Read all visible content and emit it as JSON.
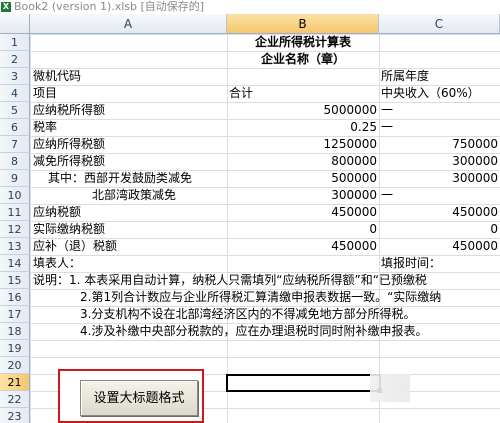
{
  "window": {
    "title": "Book2 (version 1).xlsb [自动保存的]"
  },
  "columns": [
    "A",
    "B",
    "C"
  ],
  "rows": [
    "1",
    "2",
    "3",
    "4",
    "5",
    "6",
    "7",
    "8",
    "9",
    "10",
    "11",
    "12",
    "13",
    "14",
    "15",
    "16",
    "17",
    "18",
    "19",
    "20",
    "21",
    "22",
    "23"
  ],
  "cells": {
    "r1_title": "企业所得税计算表",
    "r2_company": "企业名称（章）",
    "r3_a": "微机代码",
    "r3_c": "所属年度",
    "r4_a": "项目",
    "r4_b": "合计",
    "r4_c": "中央收入（60%）",
    "r5_a": "应纳税所得额",
    "r5_b": "5000000",
    "r5_c": "一",
    "r6_a": "税率",
    "r6_b": "0.25",
    "r6_c": "一",
    "r7_a": "应纳所得税额",
    "r7_b": "1250000",
    "r7_c": "750000",
    "r8_a": "减免所得税额",
    "r8_b": "800000",
    "r8_c": "300000",
    "r9_a": "其中：西部开发鼓励类减免",
    "r9_b": "500000",
    "r9_c": "300000",
    "r10_a": "北部湾政策减免",
    "r10_b": "300000",
    "r10_c": "一",
    "r11_a": "应纳税额",
    "r11_b": "450000",
    "r11_c": "450000",
    "r12_a": "实际缴纳税额",
    "r12_b": "0",
    "r12_c": "0",
    "r13_a": "应补（退）税额",
    "r13_b": "450000",
    "r13_c": "450000",
    "r14_a": "填表人：",
    "r14_c": "填报时间：",
    "r15": "说明：1. 本表采用自动计算，纳税人只需填列“应纳税所得额”和“已预缴税",
    "r16": "2.第1列合计数应与企业所得税汇算清缴申报表数据一致。“实际缴纳",
    "r17": "3.分支机构不设在北部湾经济区内的不得减免地方部分所得税。",
    "r18": "4.涉及补缴中央部分税款的，应在办理退税时同时附补缴申报表。"
  },
  "button": {
    "label": "设置大标题格式"
  },
  "colors": {
    "highlight": "#d0181c",
    "header_selected": "#f5c66b"
  }
}
